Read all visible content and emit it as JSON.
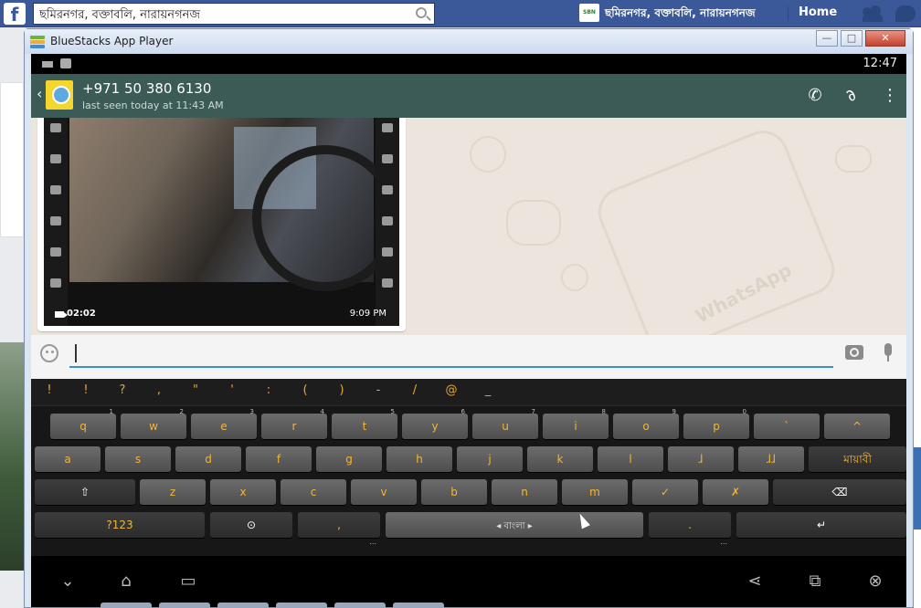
{
  "facebook": {
    "logo": "f",
    "search_value": "ছমিরনগর, বক্তাবলি, নারায়নগনজ",
    "page_logo": "SBN",
    "page_name": "ছমিরনগর, বক্তাবলি, নারায়নগনজ",
    "home_label": "Home"
  },
  "bluestacks": {
    "title": "BlueStacks App Player",
    "min_glyph": "—",
    "max_glyph": "□",
    "close_glyph": "✕"
  },
  "android": {
    "status_time": "12:47",
    "contact": {
      "number": "+971 50 380 6130",
      "last_seen": "last seen today at 11:43 AM"
    },
    "video": {
      "duration": "02:02",
      "time": "9:09 PM"
    },
    "watermark": "WhatsApp"
  },
  "keyboard": {
    "symbols": [
      "!",
      "!",
      "?",
      ",",
      "\"",
      "'",
      ":",
      "(",
      ")",
      "-",
      "/",
      "@",
      "_"
    ],
    "row1": [
      {
        "label": "q",
        "hint": "1"
      },
      {
        "label": "w",
        "hint": "2"
      },
      {
        "label": "e",
        "hint": "3"
      },
      {
        "label": "r",
        "hint": "4"
      },
      {
        "label": "t",
        "hint": "5"
      },
      {
        "label": "y",
        "hint": "6"
      },
      {
        "label": "u",
        "hint": "7"
      },
      {
        "label": "i",
        "hint": "8"
      },
      {
        "label": "o",
        "hint": "9"
      },
      {
        "label": "p",
        "hint": "0"
      },
      {
        "label": "`",
        "hint": ""
      },
      {
        "label": "^",
        "hint": ""
      }
    ],
    "row2": [
      "a",
      "s",
      "d",
      "f",
      "g",
      "h",
      "j",
      "k",
      "l",
      "ɺ",
      "ɺɺ"
    ],
    "lang_key": "মায়াবী",
    "row3": [
      "z",
      "x",
      "c",
      "v",
      "b",
      "n",
      "m",
      "✓",
      "✗"
    ],
    "num_key": "?123",
    "comma_key": ",",
    "space_label": "◂ বাংলা ▸",
    "period_key": ".",
    "sub_ellipsis": "..."
  }
}
